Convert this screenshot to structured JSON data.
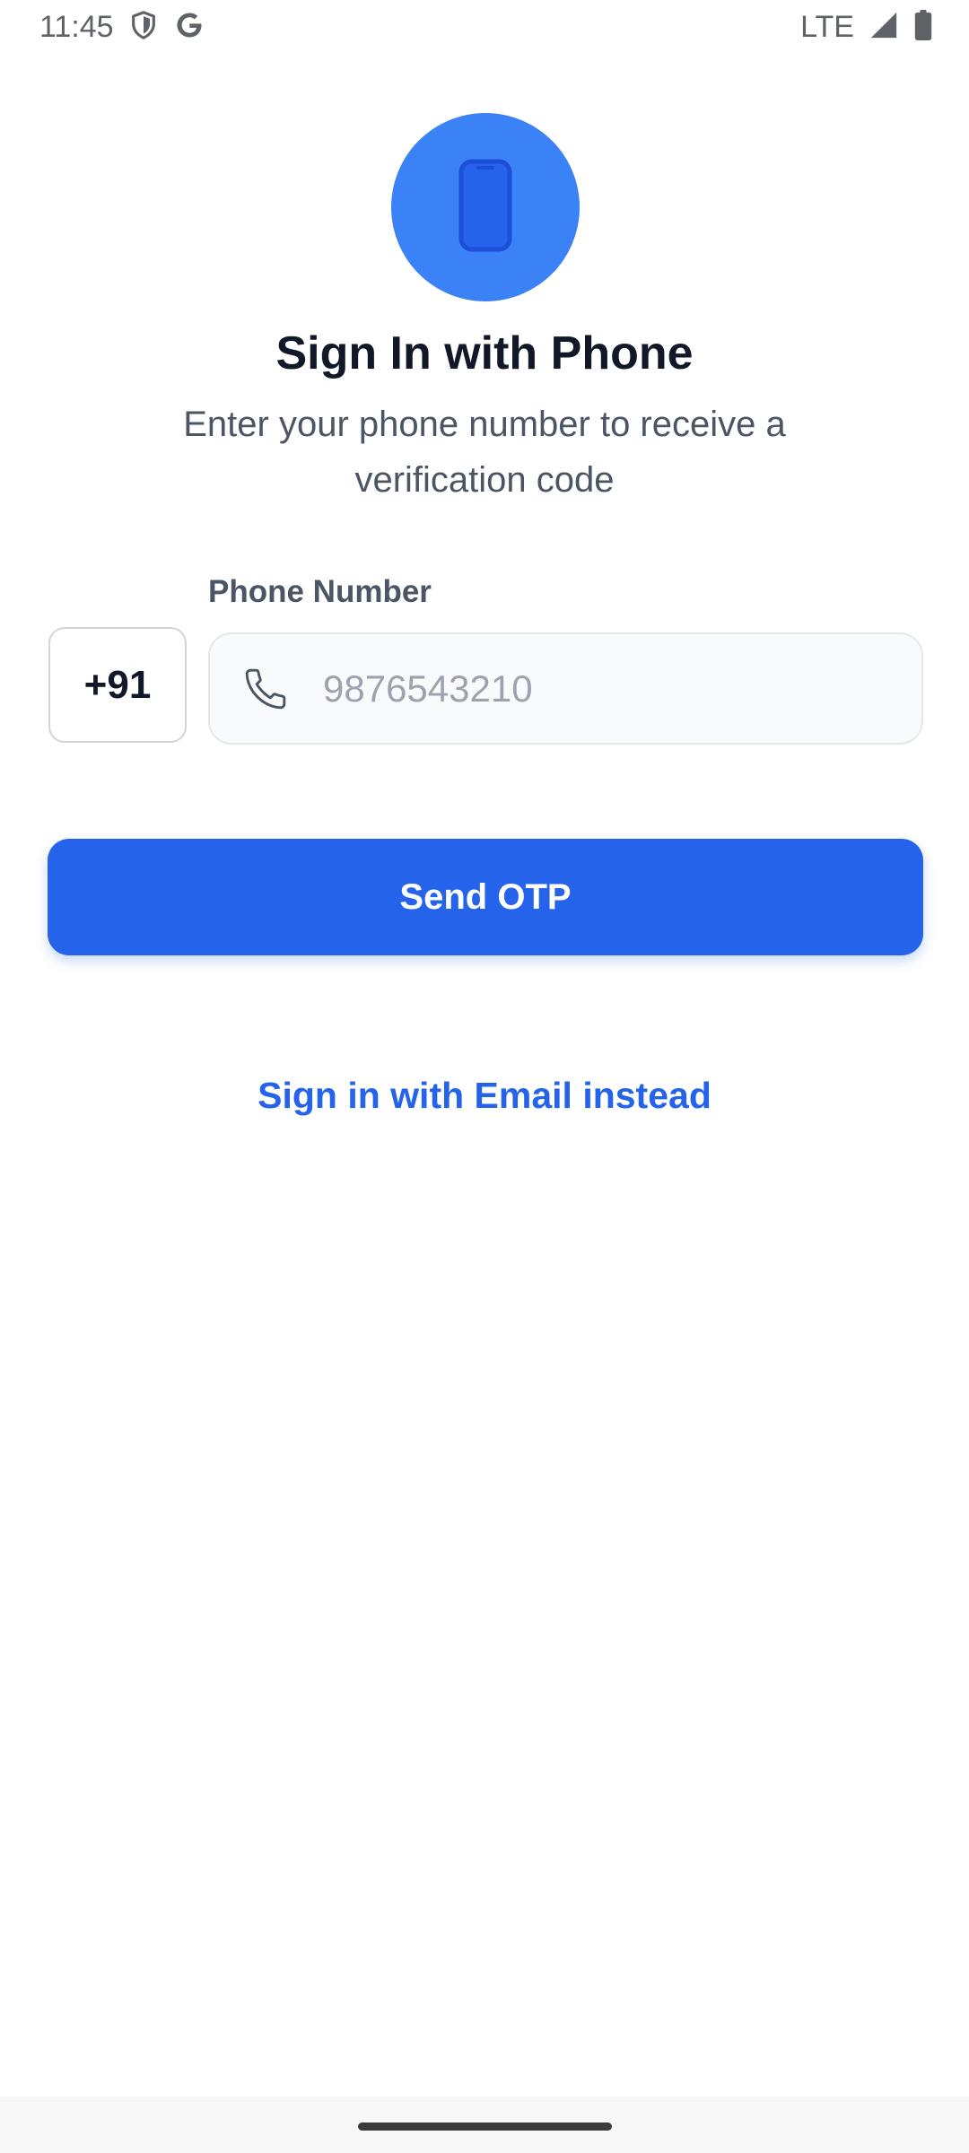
{
  "status_bar": {
    "time": "11:45",
    "network": "LTE",
    "icons": [
      "shield-icon",
      "google-g-icon",
      "signal-icon",
      "battery-icon"
    ]
  },
  "hero": {
    "icon": "smartphone-icon",
    "color": "#3b82f6"
  },
  "header": {
    "title": "Sign In with Phone",
    "subtitle": "Enter your phone number to receive a verification code"
  },
  "form": {
    "label": "Phone Number",
    "country_code": "+91",
    "phone_placeholder": "9876543210",
    "phone_value": ""
  },
  "actions": {
    "send_otp_label": "Send OTP",
    "email_link_label": "Sign in with Email instead"
  },
  "colors": {
    "primary": "#2563eb",
    "hero_circle": "#3b82f6",
    "title_text": "#111827",
    "muted_text": "#4b5563"
  }
}
